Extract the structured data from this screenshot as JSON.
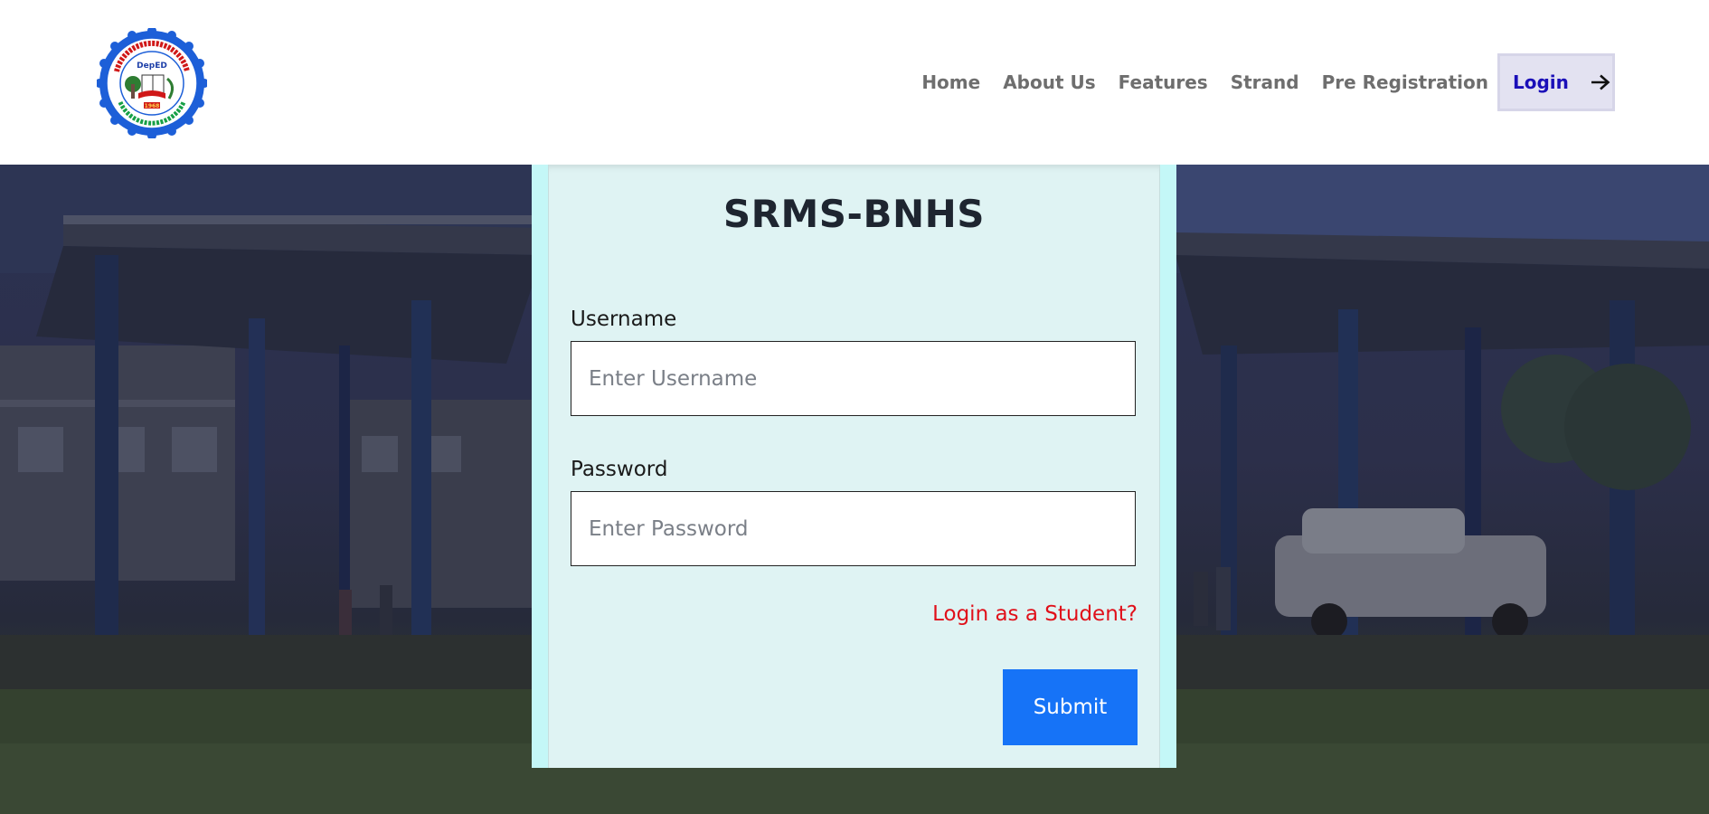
{
  "header": {
    "logo": {
      "icon": "school-seal-logo",
      "text_top": "BATO NATIONAL HIGH SCHOOL",
      "text_bottom": "Bato, Camarines Sur",
      "center_badge": "DepED",
      "motto_left": "VOX POPULI",
      "motto_right": "VOX DEI",
      "year": "1968",
      "colors": {
        "ring": "#1d5fd8",
        "text_red": "#d01818",
        "text_green": "#17a046"
      }
    },
    "nav": {
      "items": [
        {
          "label": "Home"
        },
        {
          "label": "About Us"
        },
        {
          "label": "Features"
        },
        {
          "label": "Strand"
        },
        {
          "label": "Pre Registration"
        }
      ],
      "login": {
        "label": "Login",
        "icon": "arrow-right-icon"
      }
    }
  },
  "form": {
    "title": "SRMS-BNHS",
    "username": {
      "label": "Username",
      "placeholder": "Enter Username",
      "value": ""
    },
    "password": {
      "label": "Password",
      "placeholder": "Enter Password",
      "value": ""
    },
    "student_link": "Login as a Student?",
    "submit_label": "Submit"
  },
  "colors": {
    "card_outer": "#c4f7f7",
    "card_inner": "#dff3f3",
    "submit": "#1673f7",
    "link": "#e0101a",
    "login_text": "#1a0fb8",
    "login_bg": "#e3e2f1",
    "nav_text": "#6e6e6e"
  }
}
